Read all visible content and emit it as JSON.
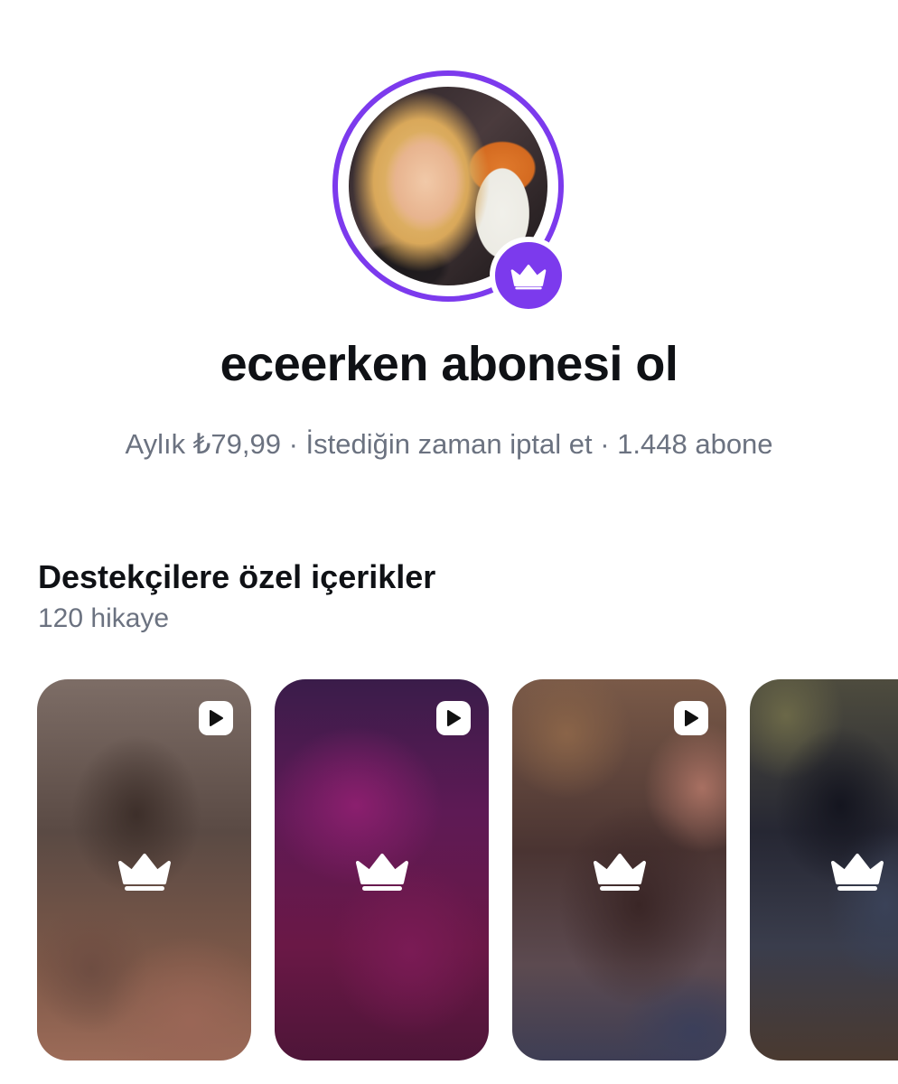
{
  "profile": {
    "title": "eceerken abonesi ol",
    "subtitle": "Aylık ₺79,99 · İstediğin zaman iptal et · 1.448 abone",
    "badge_icon": "crown-icon",
    "ring_color": "#7c3aed"
  },
  "section": {
    "title": "Destekçilere özel içerikler",
    "count": "120 hikaye"
  },
  "cards": [
    {
      "has_video": true,
      "icon": "crown-icon"
    },
    {
      "has_video": true,
      "icon": "crown-icon"
    },
    {
      "has_video": true,
      "icon": "crown-icon"
    },
    {
      "has_video": false,
      "icon": "crown-icon"
    }
  ],
  "icons": {
    "video": "play-icon",
    "locked": "crown-icon"
  },
  "colors": {
    "accent": "#7c3aed",
    "title": "#0f1115",
    "muted": "#6b7280"
  }
}
